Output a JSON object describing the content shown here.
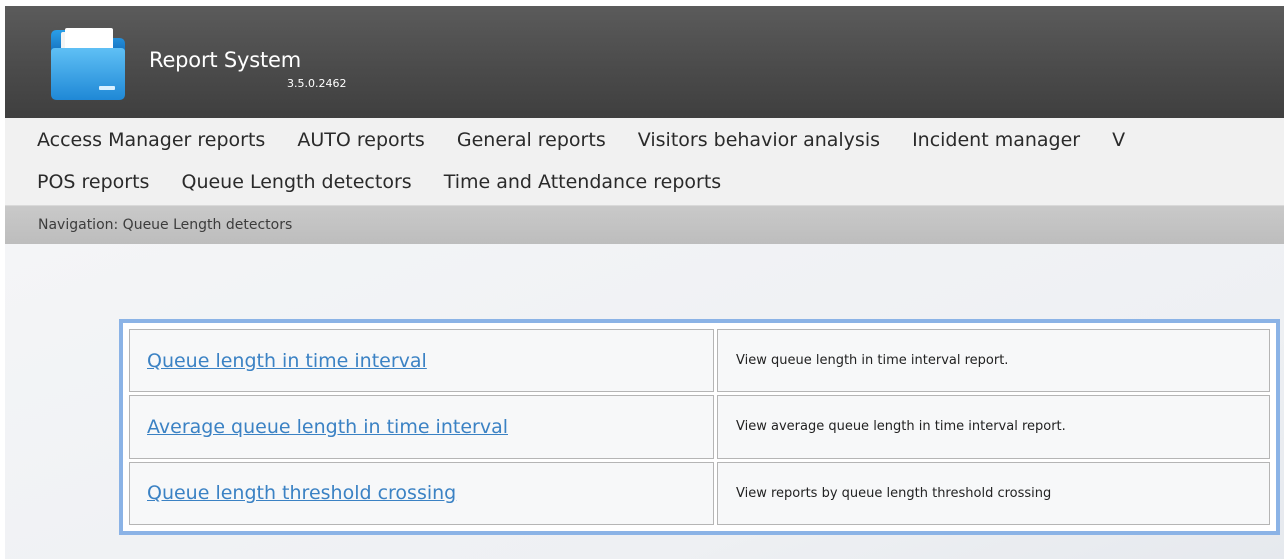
{
  "app": {
    "title": "Report System",
    "version": "3.5.0.2462",
    "logo_icon": "folder-icon"
  },
  "menu": {
    "row1": [
      "Access Manager reports",
      "AUTO reports",
      "General reports",
      "Visitors behavior analysis",
      "Incident manager",
      "V"
    ],
    "row2": [
      "POS reports",
      "Queue Length detectors",
      "Time and Attendance reports"
    ]
  },
  "breadcrumb": {
    "text": "Navigation: Queue Length detectors"
  },
  "reports": [
    {
      "link": "Queue length in time interval",
      "description": "View queue length in time interval report."
    },
    {
      "link": "Average queue length in time interval",
      "description": "View average queue length in time interval report."
    },
    {
      "link": "Queue length threshold crossing",
      "description": "View reports by queue length threshold crossing"
    }
  ],
  "colors": {
    "header": "#4b4b4b",
    "link": "#3b82c4",
    "frame": "#8bb3e6"
  }
}
